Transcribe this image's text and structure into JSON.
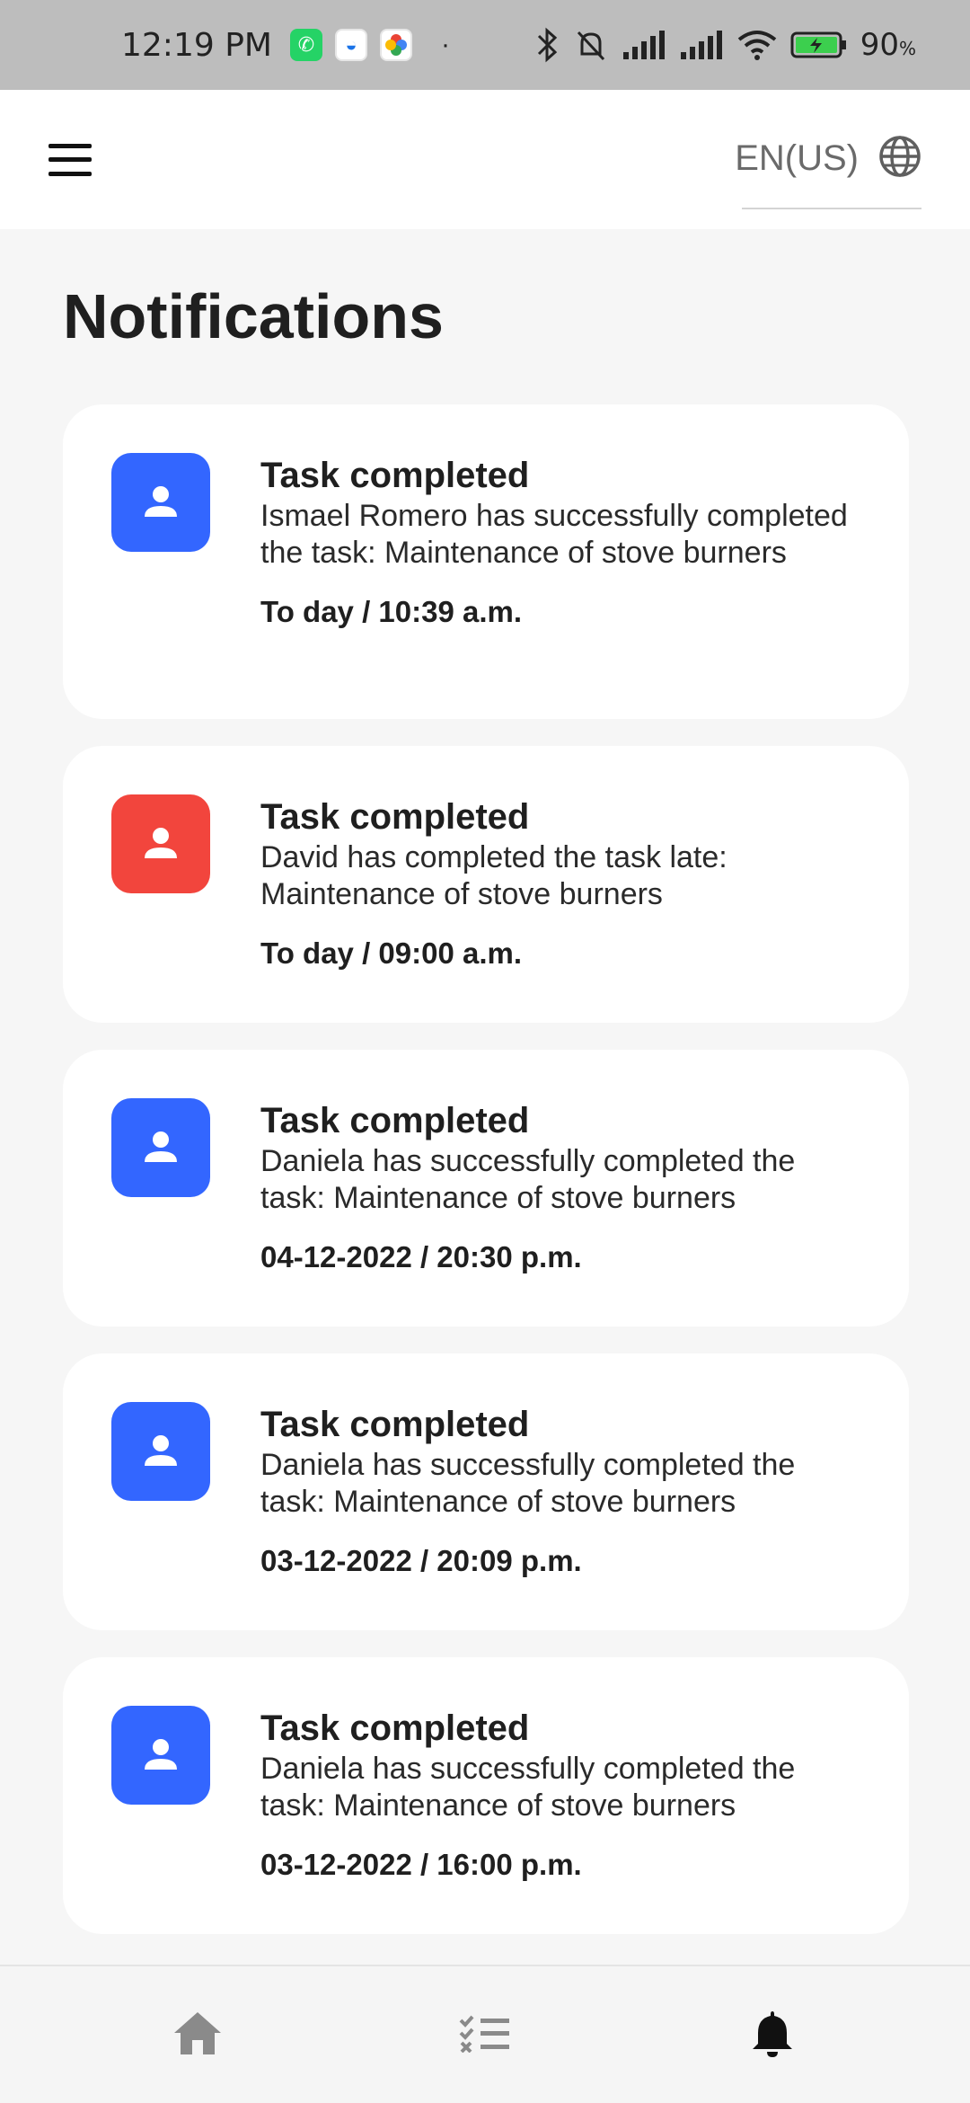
{
  "status_bar": {
    "time": "12:19 PM",
    "battery_percent": "90",
    "battery_unit": "%",
    "dot": "·"
  },
  "header": {
    "language": "EN(US)"
  },
  "page": {
    "title": "Notifications"
  },
  "notifications": [
    {
      "title": "Task completed",
      "message": "Ismael Romero has successfully completed the task: Maintenance of stove burners",
      "time": "To day / 10:39 a.m.",
      "status": "on-time"
    },
    {
      "title": "Task completed",
      "message": "David has completed the task late: Maintenance of stove burners",
      "time": "To day / 09:00 a.m.",
      "status": "late"
    },
    {
      "title": "Task completed",
      "message": "Daniela has successfully completed the task: Maintenance of stove burners",
      "time": "04-12-2022 / 20:30 p.m.",
      "status": "on-time"
    },
    {
      "title": "Task completed",
      "message": "Daniela has successfully completed the task: Maintenance of stove burners",
      "time": "03-12-2022 / 20:09 p.m.",
      "status": "on-time"
    },
    {
      "title": "Task completed",
      "message": "Daniela has successfully completed the task: Maintenance of stove burners",
      "time": "03-12-2022 / 16:00 p.m.",
      "status": "on-time"
    }
  ],
  "colors": {
    "on_time": "#3366ff",
    "late": "#f2453d",
    "nav_inactive": "#8a8a8a",
    "nav_active": "#111111"
  },
  "bottom_nav": {
    "items": [
      "home-icon",
      "task-list-icon",
      "bell-icon"
    ],
    "active": "bell-icon"
  }
}
